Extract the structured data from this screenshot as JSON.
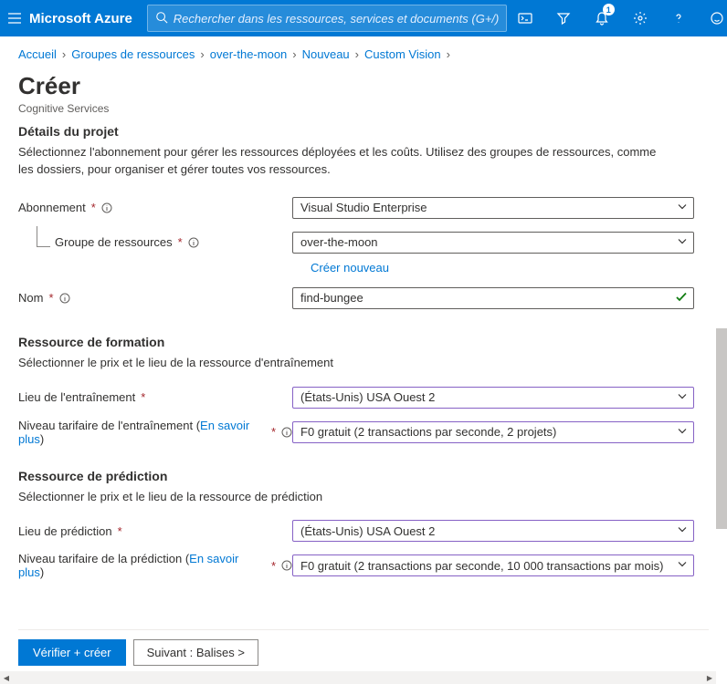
{
  "header": {
    "brand": "Microsoft Azure",
    "search_placeholder": "Rechercher dans les ressources, services et documents (G+/)",
    "notification_count": "1"
  },
  "breadcrumb": [
    {
      "label": "Accueil"
    },
    {
      "label": "Groupes de ressources"
    },
    {
      "label": "over-the-moon"
    },
    {
      "label": "Nouveau"
    },
    {
      "label": "Custom Vision"
    }
  ],
  "page": {
    "title": "Créer",
    "subtitle": "Cognitive Services"
  },
  "sections": {
    "project_details": {
      "heading": "Détails du projet",
      "description": "Sélectionnez l'abonnement pour gérer les ressources déployées et les coûts. Utilisez des groupes de ressources, comme les dossiers, pour organiser et gérer toutes vos ressources."
    },
    "fields": {
      "subscription_label": "Abonnement",
      "subscription_value": "Visual Studio Enterprise",
      "rg_label": "Groupe de ressources",
      "rg_value": "over-the-moon",
      "rg_create_new": "Créer nouveau",
      "name_label": "Nom",
      "name_value": "find-bungee"
    },
    "training": {
      "heading": "Ressource de formation",
      "description": "Sélectionner le prix et le lieu de la ressource d'entraînement",
      "location_label": "Lieu de l'entraînement",
      "location_value": "(États-Unis) USA Ouest 2",
      "tier_label_prefix": "Niveau tarifaire de l'entraînement (",
      "tier_link": "En savoir plus",
      "tier_label_suffix": ")",
      "tier_value": "F0 gratuit (2 transactions par seconde, 2 projets)"
    },
    "prediction": {
      "heading": "Ressource de prédiction",
      "description": "Sélectionner le prix et le lieu de la ressource de prédiction",
      "location_label": "Lieu de prédiction",
      "location_value": "(États-Unis) USA Ouest 2",
      "tier_label_prefix": "Niveau tarifaire de la prédiction (",
      "tier_link": "En savoir plus",
      "tier_label_suffix": ")",
      "tier_value": "F0 gratuit (2 transactions par seconde, 10 000 transactions par mois)"
    }
  },
  "footer": {
    "review_create": "Vérifier + créer",
    "next_tags": "Suivant : Balises >"
  }
}
